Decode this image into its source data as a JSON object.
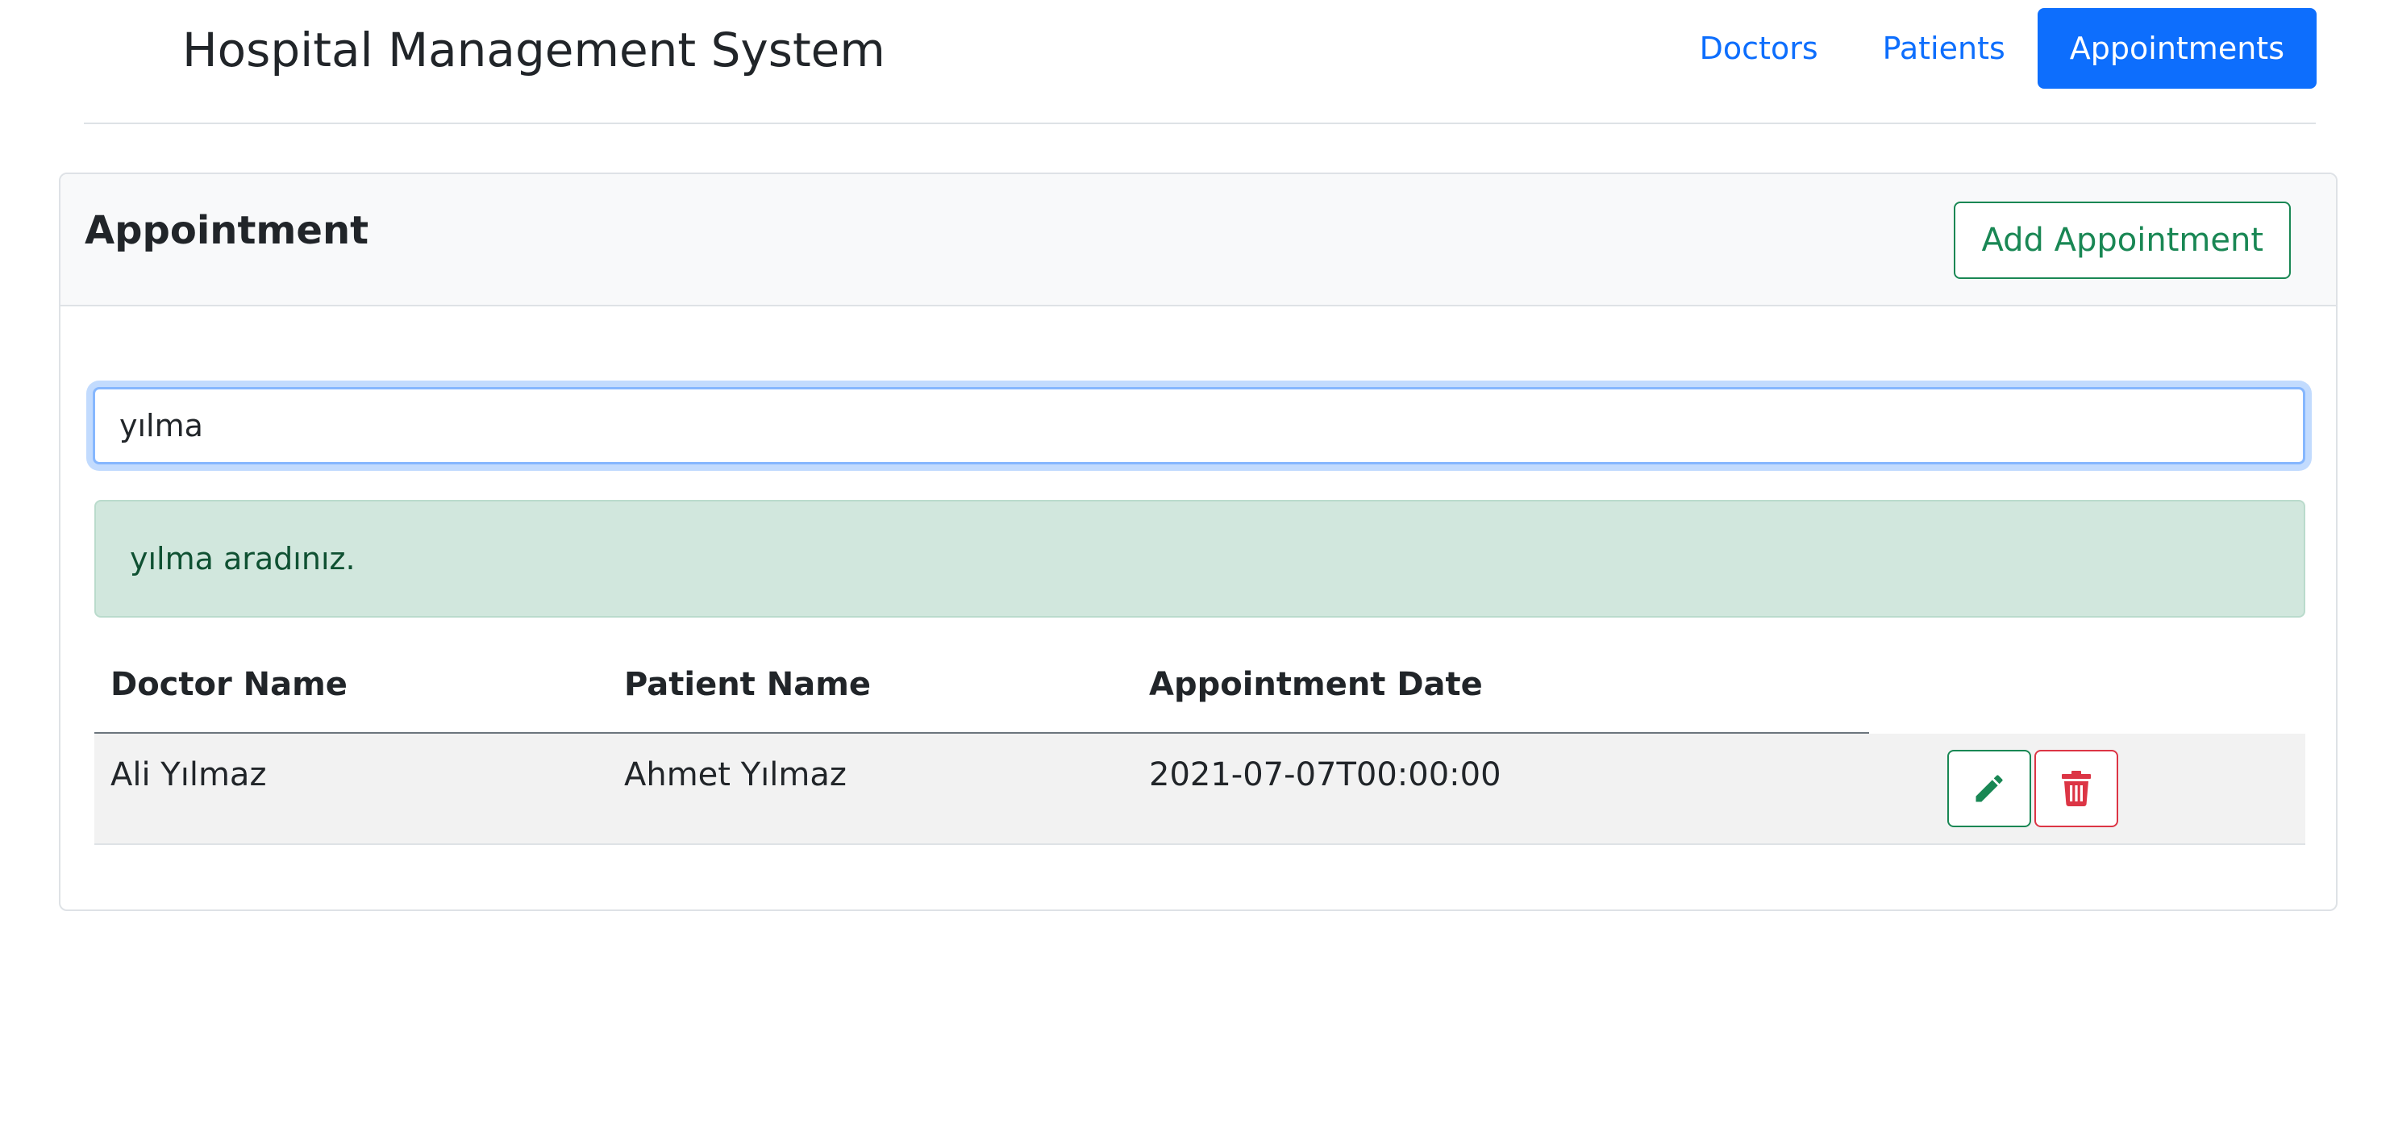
{
  "header": {
    "title": "Hospital Management System",
    "nav": [
      {
        "label": "Doctors",
        "active": false
      },
      {
        "label": "Patients",
        "active": false
      },
      {
        "label": "Appointments",
        "active": true
      }
    ]
  },
  "card": {
    "title": "Appointment",
    "add_button_label": "Add Appointment",
    "search": {
      "value": "yılma"
    },
    "alert": {
      "text": "yılma aradınız."
    },
    "table": {
      "columns": [
        "Doctor Name",
        "Patient Name",
        "Appointment Date"
      ],
      "rows": [
        {
          "doctor": "Ali Yılmaz",
          "patient": "Ahmet Yılmaz",
          "date": "2021-07-07T00:00:00"
        }
      ]
    }
  },
  "colors": {
    "primary": "#0d6efd",
    "success": "#198754",
    "danger": "#dc3545",
    "alert_bg": "#d1e7dd",
    "alert_text": "#0f5132"
  },
  "icons": {
    "edit": "pencil-icon",
    "delete": "trash-icon"
  }
}
